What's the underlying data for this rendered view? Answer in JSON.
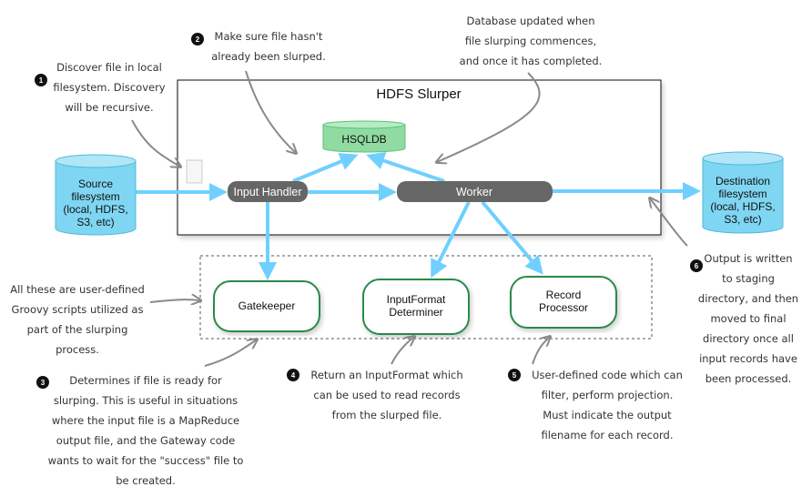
{
  "colors": {
    "flow": "#6fd0ff",
    "cylinder": "#7fd6f2",
    "db": "#8fdba2",
    "process": "#666666",
    "processor_border": "#2a8a4a"
  },
  "title": "HDFS Slurper",
  "nodes": {
    "source": [
      "Source",
      "filesystem",
      "(local, HDFS,",
      "S3, etc)"
    ],
    "destination": [
      "Destination",
      "filesystem",
      "(local, HDFS,",
      "S3, etc)"
    ],
    "db": "HSQLDB",
    "input_handler": "Input Handler",
    "worker": "Worker",
    "gatekeeper": "Gatekeeper",
    "input_format": [
      "InputFormat",
      "Determiner"
    ],
    "record_processor": [
      "Record",
      "Processor"
    ]
  },
  "notes": {
    "n1": {
      "num": "1",
      "lines": [
        "Discover file in local",
        "filesystem. Discovery",
        "will be recursive."
      ]
    },
    "n2": {
      "num": "2",
      "lines": [
        "Make sure file hasn't",
        "already been slurped."
      ]
    },
    "db": {
      "lines": [
        "Database updated when",
        "file slurping commences,",
        "and once it has completed."
      ]
    },
    "groovy": {
      "lines": [
        "All these are user-defined",
        "Groovy scripts utilized as",
        "part of the slurping",
        "process."
      ]
    },
    "n3": {
      "num": "3",
      "lines": [
        "Determines if file is ready for",
        "slurping. This is useful in situations",
        "where the input file is a MapReduce",
        "output file, and the Gateway code",
        "wants to wait for the \"success\" file to",
        "be created."
      ]
    },
    "n4": {
      "num": "4",
      "lines": [
        "Return an InputFormat which",
        "can be used to read records",
        "from the slurped file."
      ]
    },
    "n5": {
      "num": "5",
      "lines": [
        "User-defined code which can",
        "filter, perform projection.",
        "Must indicate the output",
        "filename for each record."
      ]
    },
    "n6": {
      "num": "6",
      "lines": [
        "Output is written",
        "to staging",
        "directory, and then",
        "moved to final",
        "directory once all",
        "input records have",
        "been processed."
      ]
    }
  }
}
